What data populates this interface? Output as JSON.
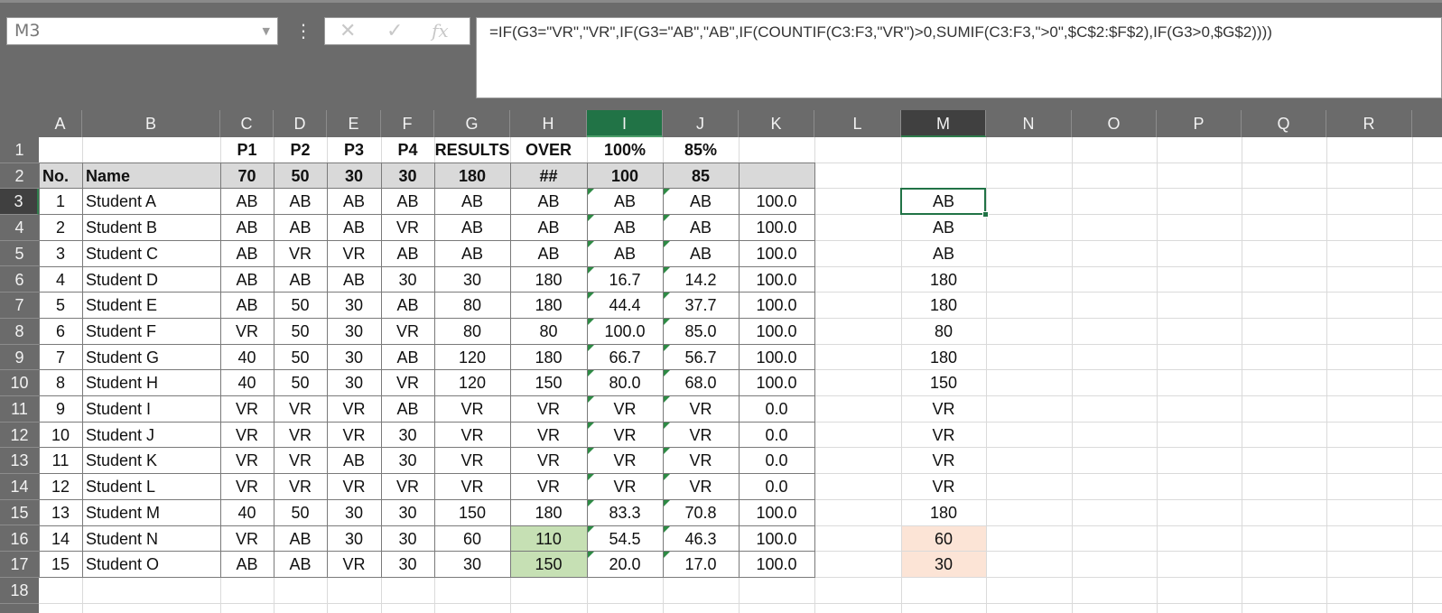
{
  "name_box": "M3",
  "formula": "=IF(G3=\"VR\",\"VR\",IF(G3=\"AB\",\"AB\",IF(COUNTIF(C3:F3,\"VR\")>0,SUMIF(C3:F3,\">0\",$C$2:$F$2),IF(G3>0,$G$2))))",
  "formula_buttons": {
    "cancel": "✕",
    "enter": "✓",
    "fx": "fx"
  },
  "columns": [
    "A",
    "B",
    "C",
    "D",
    "E",
    "F",
    "G",
    "H",
    "I",
    "J",
    "K",
    "L",
    "M",
    "N",
    "O",
    "P",
    "Q",
    "R"
  ],
  "rows": [
    "1",
    "2",
    "3",
    "4",
    "5",
    "6",
    "7",
    "8",
    "9",
    "10",
    "11",
    "12",
    "13",
    "14",
    "15",
    "16",
    "17",
    "18"
  ],
  "header_row1": {
    "C": "P1",
    "D": "P2",
    "E": "P3",
    "F": "P4",
    "G": "RESULTS",
    "H": "OVER",
    "I": "100%",
    "J": "85%"
  },
  "header_row2": {
    "A": "No.",
    "B": "Name",
    "C": "70",
    "D": "50",
    "E": "30",
    "F": "30",
    "G": "180",
    "H": "##",
    "I": "100",
    "J": "85"
  },
  "table_rows": [
    [
      "1",
      "Student A",
      "AB",
      "AB",
      "AB",
      "AB",
      "AB",
      "AB",
      "AB",
      "AB",
      "100.0",
      "AB"
    ],
    [
      "2",
      "Student B",
      "AB",
      "AB",
      "AB",
      "VR",
      "AB",
      "AB",
      "AB",
      "AB",
      "100.0",
      "AB"
    ],
    [
      "3",
      "Student C",
      "AB",
      "VR",
      "VR",
      "AB",
      "AB",
      "AB",
      "AB",
      "AB",
      "100.0",
      "AB"
    ],
    [
      "4",
      "Student D",
      "AB",
      "AB",
      "AB",
      "30",
      "30",
      "180",
      "16.7",
      "14.2",
      "100.0",
      "180"
    ],
    [
      "5",
      "Student E",
      "AB",
      "50",
      "30",
      "AB",
      "80",
      "180",
      "44.4",
      "37.7",
      "100.0",
      "180"
    ],
    [
      "6",
      "Student F",
      "VR",
      "50",
      "30",
      "VR",
      "80",
      "80",
      "100.0",
      "85.0",
      "100.0",
      "80"
    ],
    [
      "7",
      "Student G",
      "40",
      "50",
      "30",
      "AB",
      "120",
      "180",
      "66.7",
      "56.7",
      "100.0",
      "180"
    ],
    [
      "8",
      "Student H",
      "40",
      "50",
      "30",
      "VR",
      "120",
      "150",
      "80.0",
      "68.0",
      "100.0",
      "150"
    ],
    [
      "9",
      "Student I",
      "VR",
      "VR",
      "VR",
      "AB",
      "VR",
      "VR",
      "VR",
      "VR",
      "0.0",
      "VR"
    ],
    [
      "10",
      "Student J",
      "VR",
      "VR",
      "VR",
      "30",
      "VR",
      "VR",
      "VR",
      "VR",
      "0.0",
      "VR"
    ],
    [
      "11",
      "Student K",
      "VR",
      "VR",
      "AB",
      "30",
      "VR",
      "VR",
      "VR",
      "VR",
      "0.0",
      "VR"
    ],
    [
      "12",
      "Student L",
      "VR",
      "VR",
      "VR",
      "VR",
      "VR",
      "VR",
      "VR",
      "VR",
      "0.0",
      "VR"
    ],
    [
      "13",
      "Student M",
      "40",
      "50",
      "30",
      "30",
      "150",
      "180",
      "83.3",
      "70.8",
      "100.0",
      "180"
    ],
    [
      "14",
      "Student N",
      "VR",
      "AB",
      "30",
      "30",
      "60",
      "110",
      "54.5",
      "46.3",
      "100.0",
      "60"
    ],
    [
      "15",
      "Student O",
      "AB",
      "AB",
      "VR",
      "30",
      "30",
      "150",
      "20.0",
      "17.0",
      "100.0",
      "30"
    ]
  ],
  "colors": {
    "ribbon": "#6b6b6b",
    "accent": "#217346",
    "header_fill": "#d9d9d9",
    "green_fill": "#c6e0b4",
    "peach_fill": "#fce4d6"
  }
}
